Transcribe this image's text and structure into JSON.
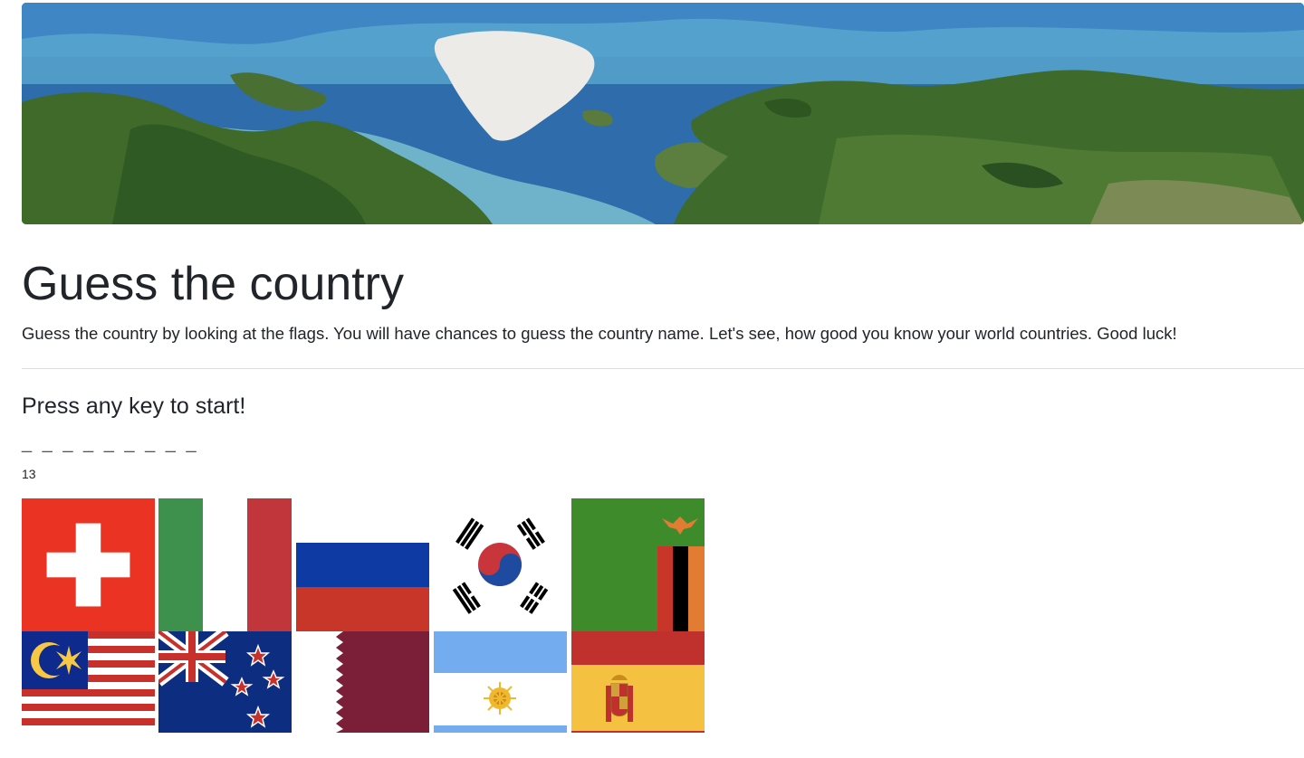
{
  "banner": {
    "icon": "world-map-banner"
  },
  "header": {
    "title": "Guess the country",
    "lead": "Guess the country by looking at the flags. You will have chances to guess the country name. Let's see, how good you know your world countries. Good luck!"
  },
  "game": {
    "prompt": "Press any key to start!",
    "blanks": "_ _ _ _ _ _ _ _ _",
    "remaining_guesses": "13",
    "flags": [
      {
        "country": "Switzerland",
        "icon": "switzerland-flag-icon"
      },
      {
        "country": "Italy",
        "icon": "italy-flag-icon"
      },
      {
        "country": "Russia",
        "icon": "russia-flag-icon"
      },
      {
        "country": "South Korea",
        "icon": "south-korea-flag-icon"
      },
      {
        "country": "Zambia",
        "icon": "zambia-flag-icon"
      },
      {
        "country": "Malaysia",
        "icon": "malaysia-flag-icon"
      },
      {
        "country": "New Zealand",
        "icon": "new-zealand-flag-icon"
      },
      {
        "country": "Qatar",
        "icon": "qatar-flag-icon"
      },
      {
        "country": "Argentina",
        "icon": "argentina-flag-icon"
      },
      {
        "country": "Spain",
        "icon": "spain-flag-icon"
      }
    ]
  }
}
